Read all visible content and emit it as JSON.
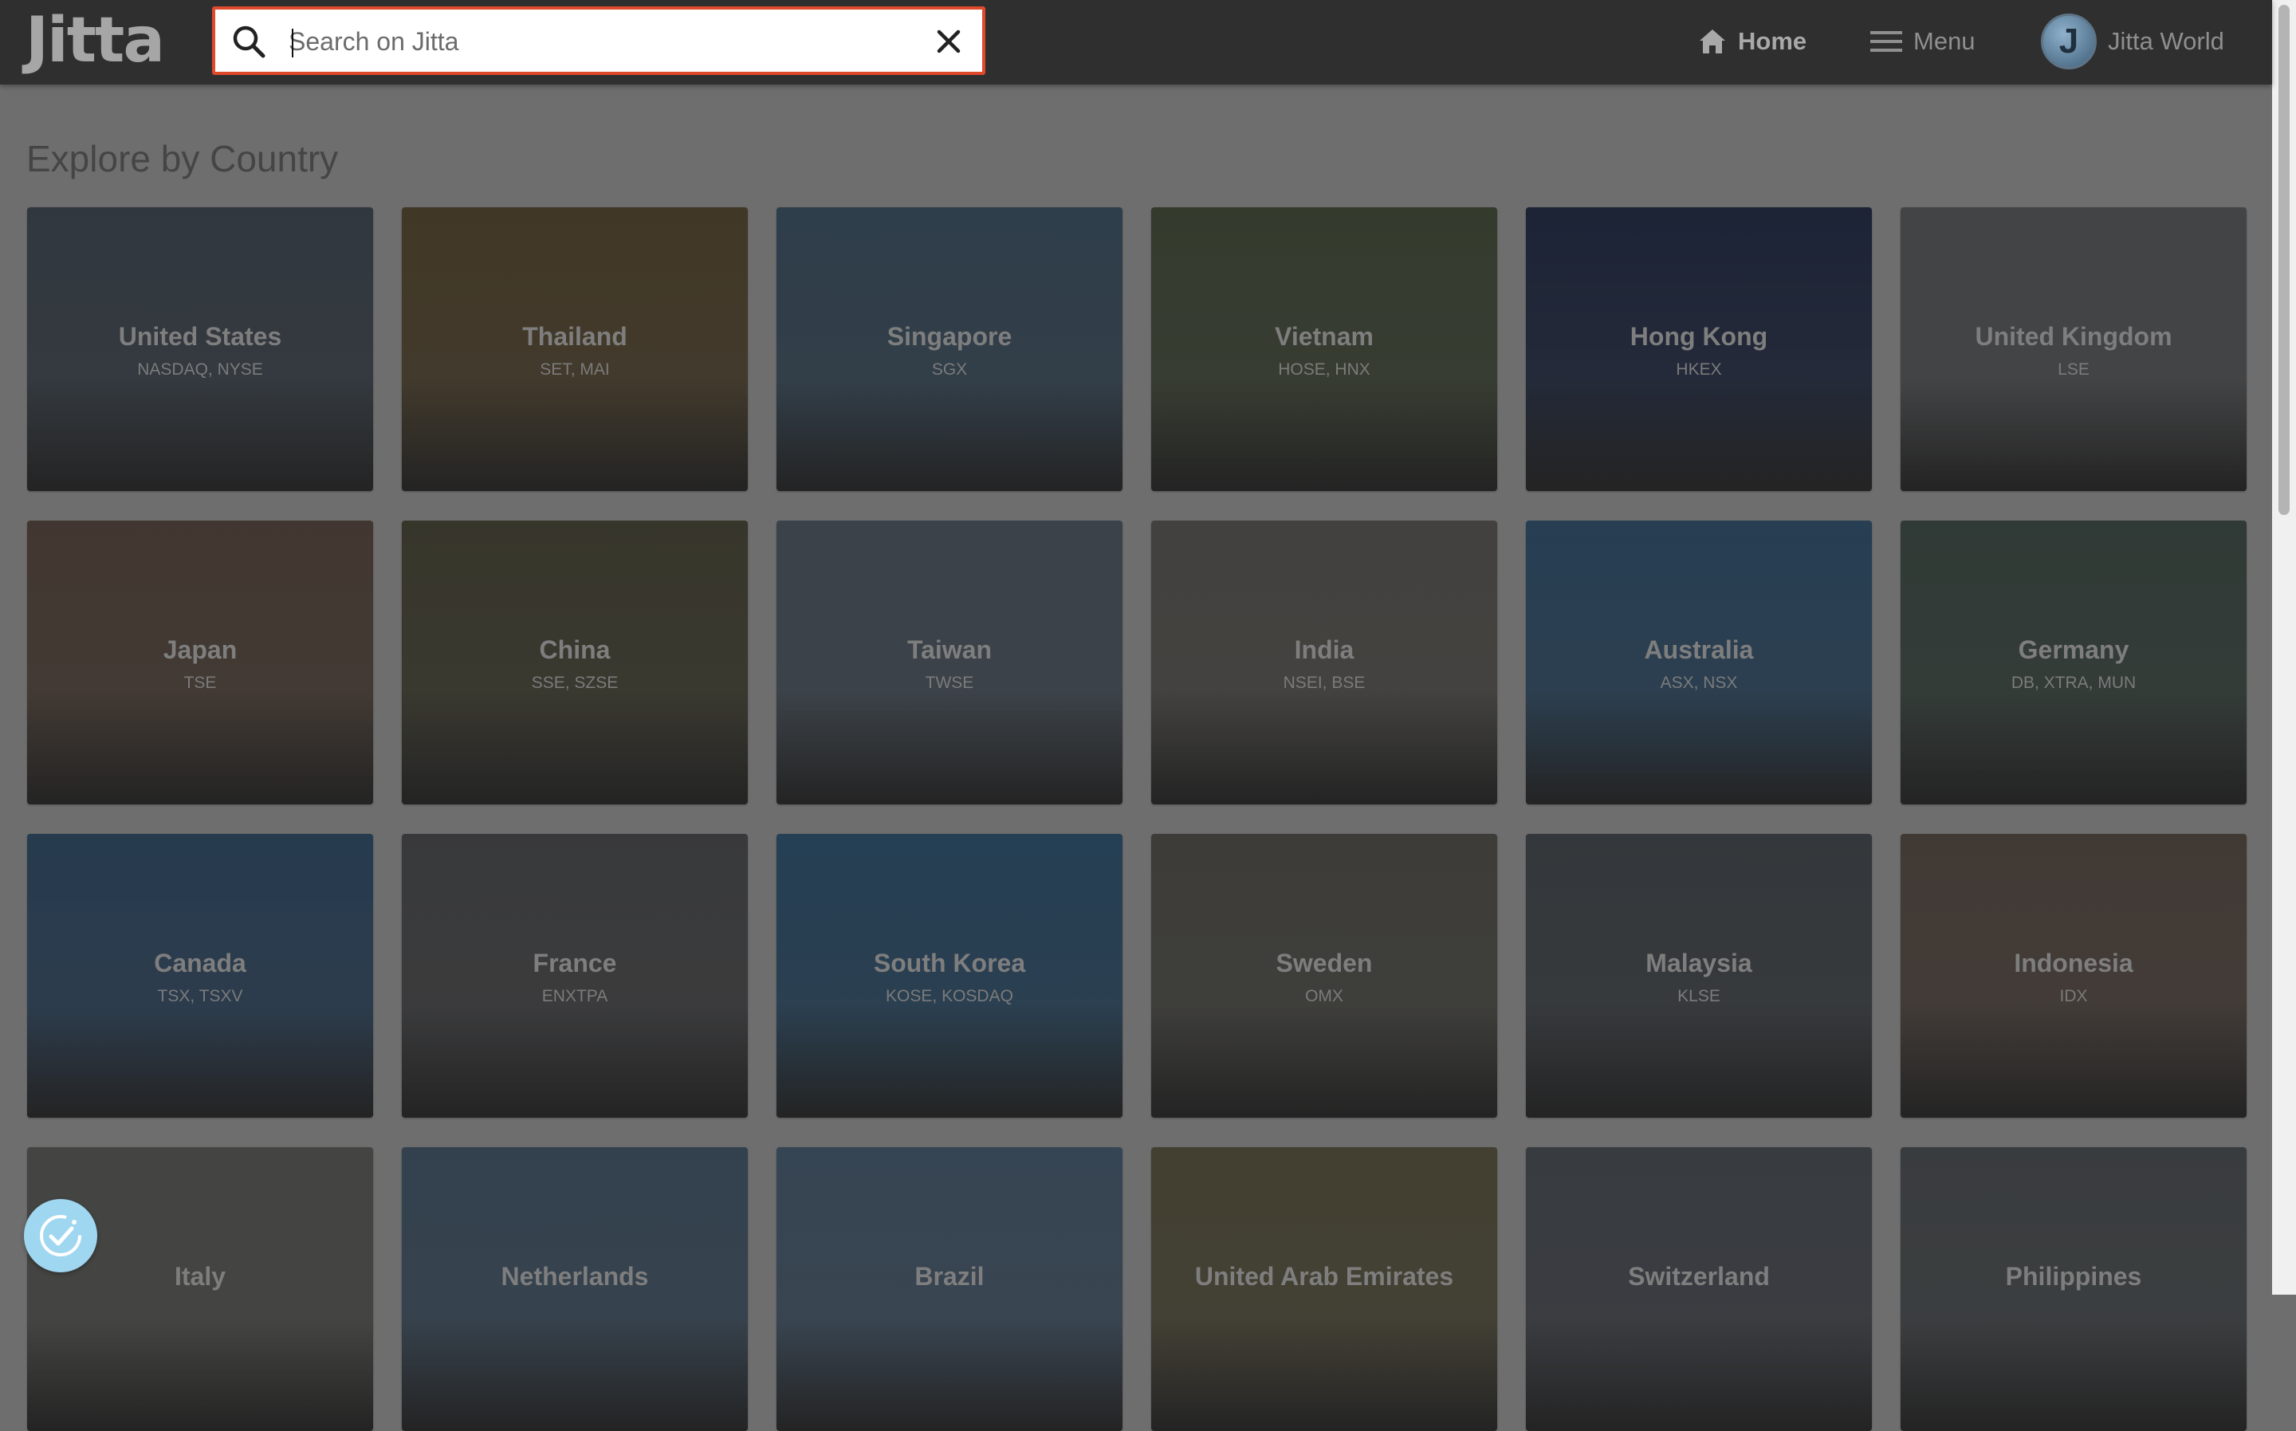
{
  "header": {
    "logo": "Jitta",
    "search": {
      "placeholder": "Search on Jitta",
      "value": ""
    },
    "nav": {
      "home_label": "Home",
      "menu_label": "Menu",
      "user_label": "Jitta World",
      "avatar_initial": "J"
    }
  },
  "main": {
    "section_title": "Explore by Country",
    "countries": [
      {
        "name": "United States",
        "exchanges": "NASDAQ, NYSE",
        "color": "#4f5a66"
      },
      {
        "name": "Thailand",
        "exchanges": "SET, MAI",
        "color": "#6a5a3e"
      },
      {
        "name": "Singapore",
        "exchanges": "SGX",
        "color": "#4b6479"
      },
      {
        "name": "Vietnam",
        "exchanges": "HOSE, HNX",
        "color": "#55604a"
      },
      {
        "name": "Hong Kong",
        "exchanges": "HKEX",
        "color": "#2e3a58"
      },
      {
        "name": "United Kingdom",
        "exchanges": "LSE",
        "color": "#6d6f72"
      },
      {
        "name": "Japan",
        "exchanges": "TSE",
        "color": "#6b5a4e"
      },
      {
        "name": "China",
        "exchanges": "SSE, SZSE",
        "color": "#5a5846"
      },
      {
        "name": "Taiwan",
        "exchanges": "TWSE",
        "color": "#5f6b78"
      },
      {
        "name": "India",
        "exchanges": "NSEI, BSE",
        "color": "#6c6a66"
      },
      {
        "name": "Australia",
        "exchanges": "ASX, NSX",
        "color": "#3f6586"
      },
      {
        "name": "Germany",
        "exchanges": "DB, XTRA, MUN",
        "color": "#4e5e57"
      },
      {
        "name": "Canada",
        "exchanges": "TSX, TSXV",
        "color": "#3f5f80"
      },
      {
        "name": "France",
        "exchanges": "ENXTPA",
        "color": "#5c5d60"
      },
      {
        "name": "South Korea",
        "exchanges": "KOSE, KOSDAQ",
        "color": "#3c6688"
      },
      {
        "name": "Sweden",
        "exchanges": "OMX",
        "color": "#63625c"
      },
      {
        "name": "Malaysia",
        "exchanges": "KLSE",
        "color": "#545a60"
      },
      {
        "name": "Indonesia",
        "exchanges": "IDX",
        "color": "#6a5d55"
      },
      {
        "name": "Italy",
        "exchanges": "",
        "color": "#6f6f6b"
      },
      {
        "name": "Netherlands",
        "exchanges": "",
        "color": "#536a80"
      },
      {
        "name": "Brazil",
        "exchanges": "",
        "color": "#587088"
      },
      {
        "name": "United Arab Emirates",
        "exchanges": "",
        "color": "#6c6850"
      },
      {
        "name": "Switzerland",
        "exchanges": "",
        "color": "#5b6068"
      },
      {
        "name": "Philippines",
        "exchanges": "",
        "color": "#5d6266"
      }
    ]
  },
  "colors": {
    "accent_border": "#e0492b",
    "topbar_bg": "#2f2f2f",
    "fab_bg": "#9fd6f0"
  },
  "icons": {
    "search": "search-icon",
    "clear": "close-icon",
    "home": "home-icon",
    "menu": "hamburger-icon",
    "fab": "accessibility-check-icon"
  }
}
